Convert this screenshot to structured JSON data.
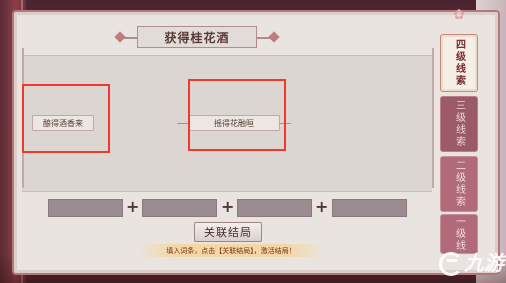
{
  "panel": {
    "title": "获得桂花酒"
  },
  "clues": [
    {
      "text": "酿得酒香来"
    },
    {
      "text": "摇得花融晅"
    }
  ],
  "slots": {
    "count": 4,
    "plus_sign": "+"
  },
  "actions": {
    "link_button_label": "关联结局",
    "hint_text": "填入词条，点击【关联结局】，激活结局！"
  },
  "tabs": [
    {
      "label": "四级线索",
      "active": true
    },
    {
      "label": "三级线索",
      "active": false
    },
    {
      "label": "二级线索",
      "active": false
    },
    {
      "label": "一级线",
      "active": false
    }
  ],
  "watermark": {
    "text": "九游"
  },
  "colors": {
    "highlight": "#f0382e",
    "panel_bg": "#e9e4e0",
    "frame": "#b77678",
    "tab_active": "#f5efe8",
    "tab_inactive": "#b06a78"
  }
}
